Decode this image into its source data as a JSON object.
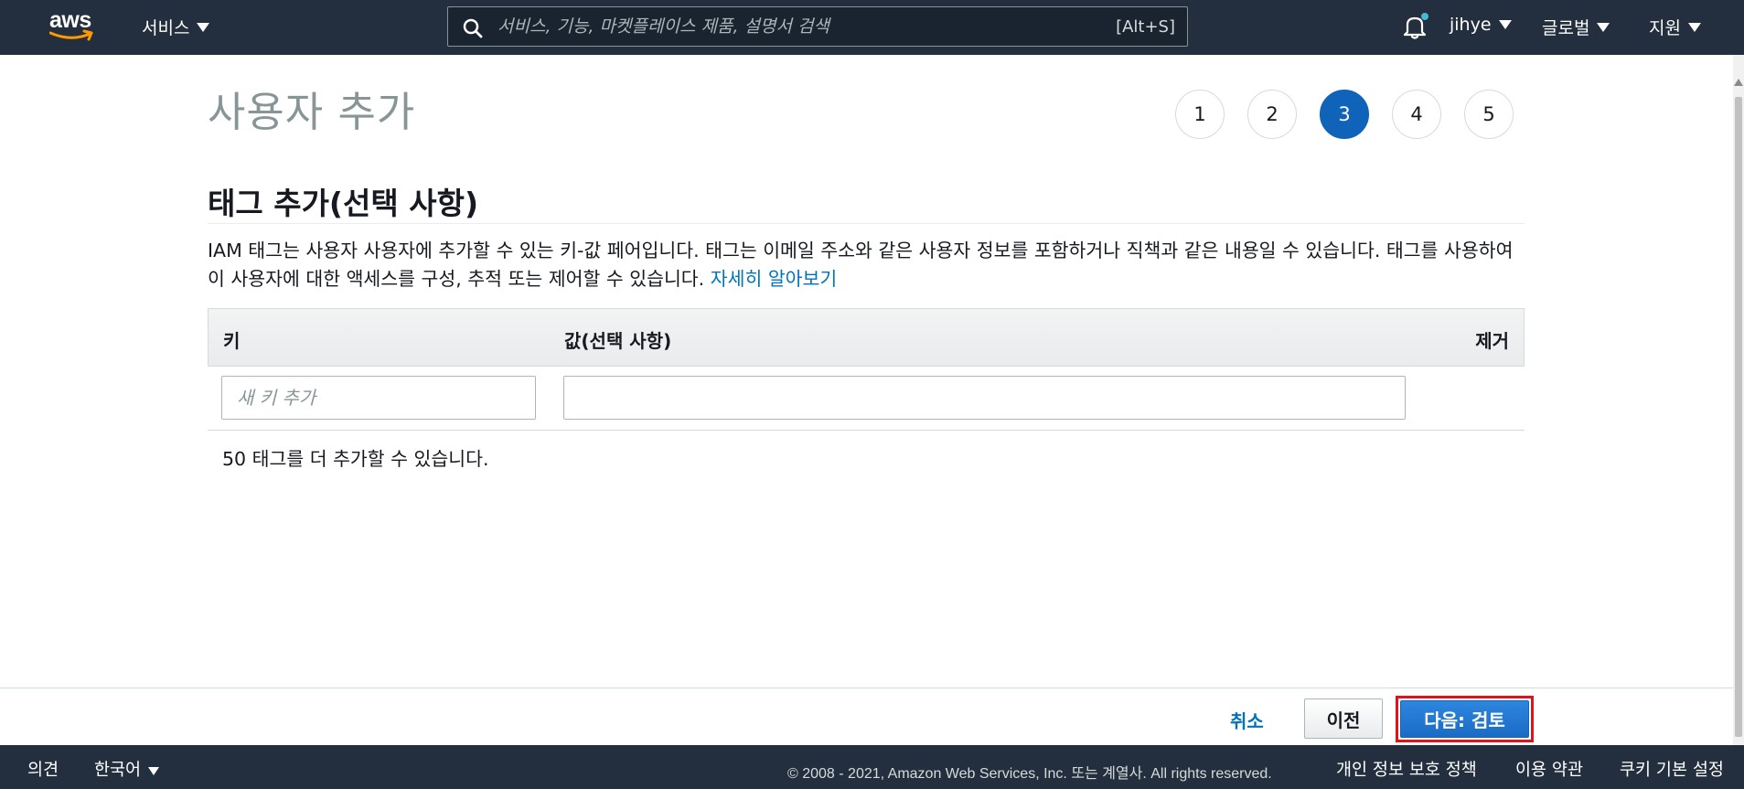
{
  "topnav": {
    "logo_text": "aws",
    "services_label": "서비스",
    "search_placeholder": "서비스, 기능, 마켓플레이스 제품, 설명서 검색",
    "search_shortcut": "[Alt+S]",
    "user_label": "jihye",
    "region_label": "글로벌",
    "support_label": "지원",
    "icons": {
      "search": "search-icon",
      "notifications": "bell-icon"
    }
  },
  "page": {
    "title": "사용자 추가",
    "steps": [
      "1",
      "2",
      "3",
      "4",
      "5"
    ],
    "active_step": "3"
  },
  "section": {
    "title": "태그 추가(선택 사항)",
    "description": "IAM 태그는 사용자 사용자에 추가할 수 있는 키-값 페어입니다. 태그는 이메일 주소와 같은 사용자 정보를 포함하거나 직책과 같은 내용일 수 있습니다. 태그를 사용하여 이 사용자에 대한 액세스를 구성, 추적 또는 제어할 수 있습니다.",
    "learn_more": "자세히 알아보기"
  },
  "tag_table": {
    "headers": {
      "key": "키",
      "value": "값(선택 사항)",
      "remove": "제거"
    },
    "new_key_placeholder": "새 키 추가",
    "new_key_value": "",
    "new_value_value": "",
    "remaining_text": "50 태그를 더 추가할 수 있습니다."
  },
  "actions": {
    "cancel": "취소",
    "previous": "이전",
    "next": "다음: 검토",
    "highlight_color": "#e0121a"
  },
  "footer": {
    "feedback": "의견",
    "language": "한국어",
    "copyright": "© 2008 - 2021, Amazon Web Services, Inc. 또는 계열사. All rights reserved.",
    "privacy": "개인 정보 보호 정책",
    "terms": "이용 약관",
    "cookies": "쿠키 기본 설정"
  },
  "colors": {
    "nav_bg": "#232f3e",
    "primary": "#0f63b8",
    "link": "#0073bb"
  }
}
